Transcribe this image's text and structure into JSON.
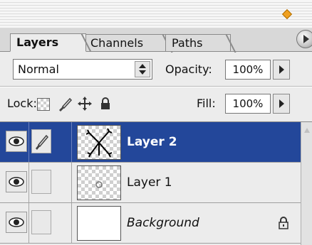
{
  "tabs": [
    {
      "label": "Layers",
      "active": true
    },
    {
      "label": "Channels",
      "active": false
    },
    {
      "label": "Paths",
      "active": false
    }
  ],
  "blend_mode": {
    "value": "Normal"
  },
  "opacity": {
    "label": "Opacity:",
    "value": "100%"
  },
  "lock": {
    "label": "Lock:"
  },
  "fill": {
    "label": "Fill:",
    "value": "100%"
  },
  "layers": [
    {
      "name": "Layer 2",
      "selected": true,
      "visible": true,
      "linked_brush": true
    },
    {
      "name": "Layer 1",
      "selected": false,
      "visible": true
    },
    {
      "name": "Background",
      "selected": false,
      "visible": true,
      "locked": true
    }
  ],
  "colors": {
    "selection": "#23479a",
    "panel_bg": "#ececec"
  }
}
